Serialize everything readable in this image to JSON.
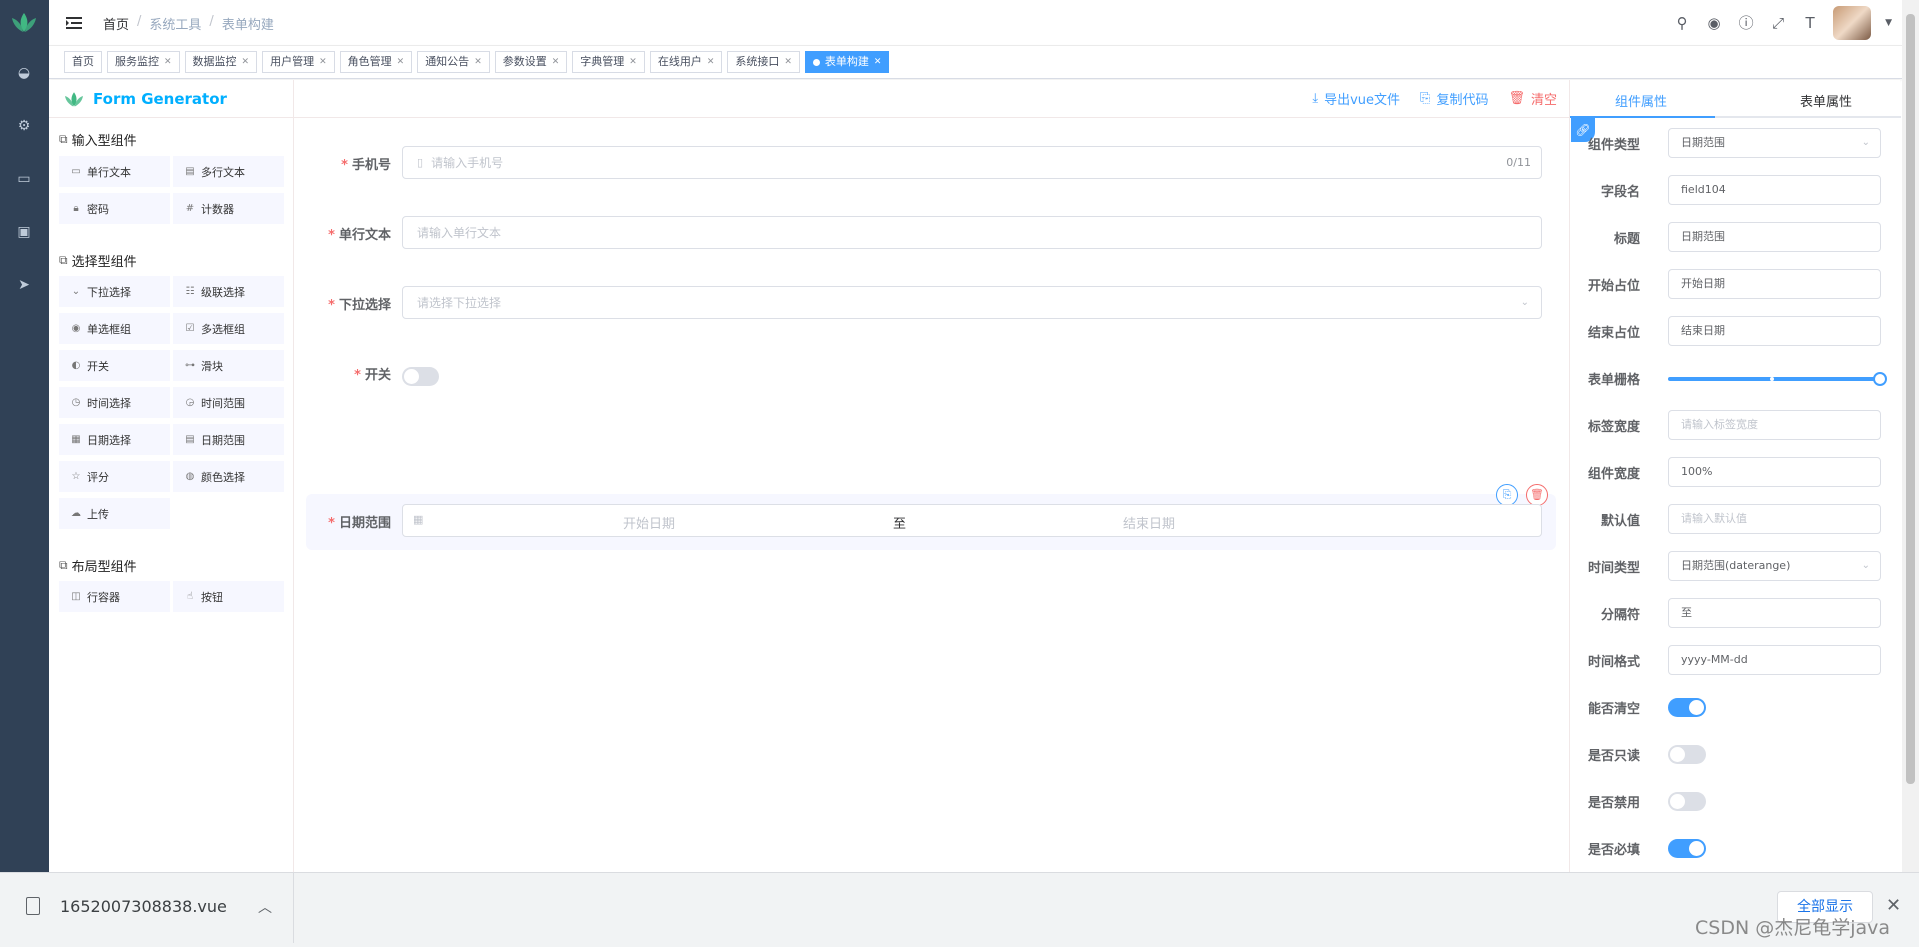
{
  "breadcrumb": {
    "home": "首页",
    "section": "系统工具",
    "current": "表单构建"
  },
  "tags": [
    {
      "label": "首页"
    },
    {
      "label": "服务监控"
    },
    {
      "label": "数据监控"
    },
    {
      "label": "用户管理"
    },
    {
      "label": "角色管理"
    },
    {
      "label": "通知公告"
    },
    {
      "label": "参数设置"
    },
    {
      "label": "字典管理"
    },
    {
      "label": "在线用户"
    },
    {
      "label": "系统接口"
    },
    {
      "label": "表单构建"
    }
  ],
  "left_panel": {
    "title": "Form Generator",
    "input_group": {
      "title": "输入型组件",
      "items": [
        "单行文本",
        "多行文本",
        "密码",
        "计数器"
      ]
    },
    "select_group": {
      "title": "选择型组件",
      "items": [
        "下拉选择",
        "级联选择",
        "单选框组",
        "多选框组",
        "开关",
        "滑块",
        "时间选择",
        "时间范围",
        "日期选择",
        "日期范围",
        "评分",
        "颜色选择",
        "上传"
      ]
    },
    "layout_group": {
      "title": "布局型组件",
      "items": [
        "行容器",
        "按钮"
      ]
    }
  },
  "actions": {
    "export": "导出vue文件",
    "copy": "复制代码",
    "clear": "清空"
  },
  "form": {
    "phone": {
      "label": "手机号",
      "placeholder": "请输入手机号",
      "count": "0/11"
    },
    "text": {
      "label": "单行文本",
      "placeholder": "请输入单行文本"
    },
    "select": {
      "label": "下拉选择",
      "placeholder": "请选择下拉选择"
    },
    "switch": {
      "label": "开关"
    },
    "daterange": {
      "label": "日期范围",
      "start": "开始日期",
      "sep": "至",
      "end": "结束日期"
    }
  },
  "right_panel": {
    "tab_component": "组件属性",
    "tab_form": "表单属性",
    "props": {
      "type": {
        "label": "组件类型",
        "value": "日期范围"
      },
      "field": {
        "label": "字段名",
        "value": "field104"
      },
      "title": {
        "label": "标题",
        "value": "日期范围"
      },
      "start_ph": {
        "label": "开始占位",
        "value": "开始日期"
      },
      "end_ph": {
        "label": "结束占位",
        "value": "结束日期"
      },
      "grid": {
        "label": "表单栅格"
      },
      "label_width": {
        "label": "标签宽度",
        "placeholder": "请输入标签宽度"
      },
      "comp_width": {
        "label": "组件宽度",
        "value": "100%"
      },
      "default": {
        "label": "默认值",
        "placeholder": "请输入默认值"
      },
      "time_type": {
        "label": "时间类型",
        "value": "日期范围(daterange)"
      },
      "separator": {
        "label": "分隔符",
        "value": "至"
      },
      "format": {
        "label": "时间格式",
        "value": "yyyy-MM-dd"
      },
      "clearable": {
        "label": "能否清空",
        "on": true
      },
      "readonly": {
        "label": "是否只读",
        "on": false
      },
      "disabled": {
        "label": "是否禁用",
        "on": false
      },
      "required": {
        "label": "是否必填",
        "on": true
      }
    }
  },
  "download_bar": {
    "file": "1652007308838.vue",
    "show_all": "全部显示"
  },
  "watermark": "CSDN @杰尼龟学java",
  "colors": {
    "primary": "#409eff",
    "danger": "#f56c6c",
    "sidebar": "#304156"
  }
}
